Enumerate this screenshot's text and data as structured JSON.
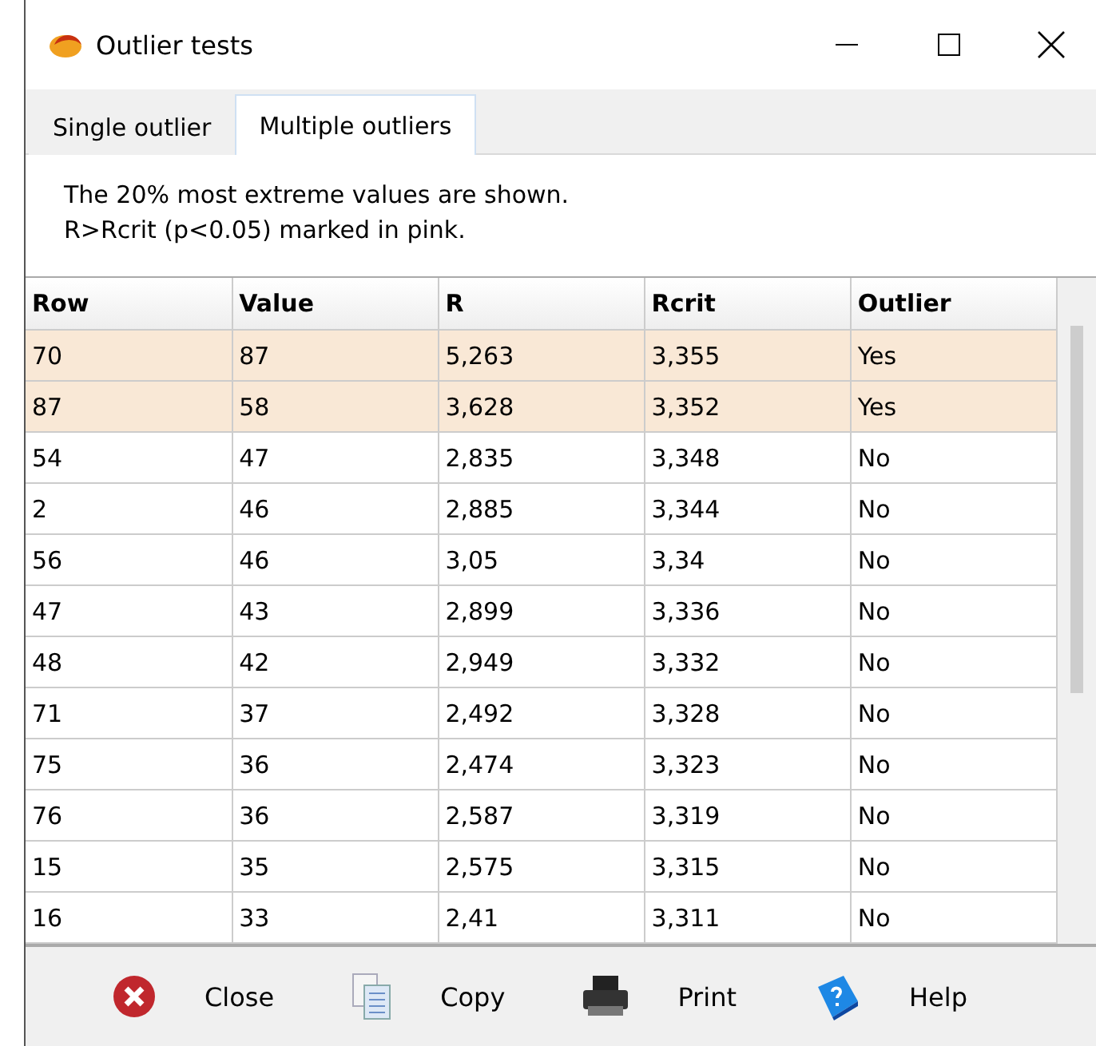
{
  "window": {
    "title": "Outlier tests"
  },
  "tabs": [
    {
      "label": "Single outlier",
      "selected": false
    },
    {
      "label": "Multiple outliers",
      "selected": true
    }
  ],
  "message": [
    "The 20% most extreme values are shown.",
    "R>Rcrit (p<0.05) marked in pink."
  ],
  "table": {
    "columns": [
      "Row",
      "Value",
      "R",
      "Rcrit",
      "Outlier"
    ],
    "rows": [
      {
        "cells": [
          "70",
          "87",
          "5,263",
          "3,355",
          "Yes"
        ],
        "highlighted": true
      },
      {
        "cells": [
          "87",
          "58",
          "3,628",
          "3,352",
          "Yes"
        ],
        "highlighted": true
      },
      {
        "cells": [
          "54",
          "47",
          "2,835",
          "3,348",
          "No"
        ],
        "highlighted": false
      },
      {
        "cells": [
          "2",
          "46",
          "2,885",
          "3,344",
          "No"
        ],
        "highlighted": false
      },
      {
        "cells": [
          "56",
          "46",
          "3,05",
          "3,34",
          "No"
        ],
        "highlighted": false
      },
      {
        "cells": [
          "47",
          "43",
          "2,899",
          "3,336",
          "No"
        ],
        "highlighted": false
      },
      {
        "cells": [
          "48",
          "42",
          "2,949",
          "3,332",
          "No"
        ],
        "highlighted": false
      },
      {
        "cells": [
          "71",
          "37",
          "2,492",
          "3,328",
          "No"
        ],
        "highlighted": false
      },
      {
        "cells": [
          "75",
          "36",
          "2,474",
          "3,323",
          "No"
        ],
        "highlighted": false
      },
      {
        "cells": [
          "76",
          "36",
          "2,587",
          "3,319",
          "No"
        ],
        "highlighted": false
      },
      {
        "cells": [
          "15",
          "35",
          "2,575",
          "3,315",
          "No"
        ],
        "highlighted": false
      },
      {
        "cells": [
          "16",
          "33",
          "2,41",
          "3,311",
          "No"
        ],
        "highlighted": false
      }
    ]
  },
  "buttons": [
    {
      "kind": "close",
      "label": "Close"
    },
    {
      "kind": "copy",
      "label": "Copy"
    },
    {
      "kind": "print",
      "label": "Print"
    },
    {
      "kind": "help",
      "label": "Help"
    }
  ]
}
